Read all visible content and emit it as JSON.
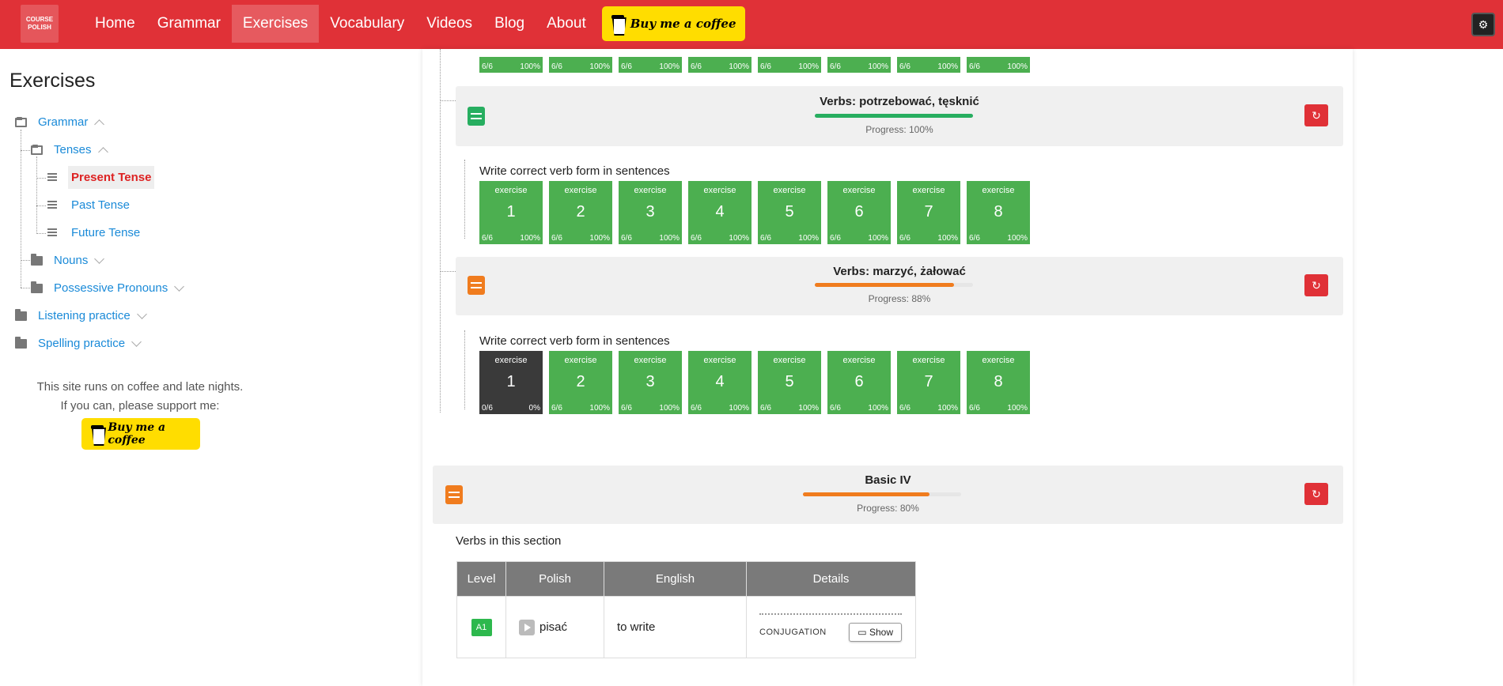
{
  "brand": {
    "logo_line1": "COURSE",
    "logo_line2": "POLISH"
  },
  "nav": {
    "home": "Home",
    "grammar": "Grammar",
    "exercises": "Exercises",
    "vocabulary": "Vocabulary",
    "videos": "Videos",
    "blog": "Blog",
    "about": "About",
    "coffee": "Buy me a coffee"
  },
  "sidebar": {
    "title": "Exercises",
    "grammar": "Grammar",
    "tenses": "Tenses",
    "present": "Present Tense",
    "past": "Past Tense",
    "future": "Future Tense",
    "nouns": "Nouns",
    "possessive": "Possessive Pronouns",
    "listening": "Listening practice",
    "spelling": "Spelling practice",
    "support1": "This site runs on coffee and late nights.",
    "support2": "If you can, please support me:",
    "coffee": "Buy me a coffee"
  },
  "exercise_label": "exercise",
  "top_row": {
    "score": "6/6",
    "pct": "100%"
  },
  "section1": {
    "title": "Verbs: potrzebować, tęsknić",
    "progress_text": "Progress: 100%",
    "progress": 100,
    "color": "#27ae60",
    "subtitle": "Write correct verb form in sentences",
    "exercises": [
      {
        "n": "1",
        "score": "6/6",
        "pct": "100%"
      },
      {
        "n": "2",
        "score": "6/6",
        "pct": "100%"
      },
      {
        "n": "3",
        "score": "6/6",
        "pct": "100%"
      },
      {
        "n": "4",
        "score": "6/6",
        "pct": "100%"
      },
      {
        "n": "5",
        "score": "6/6",
        "pct": "100%"
      },
      {
        "n": "6",
        "score": "6/6",
        "pct": "100%"
      },
      {
        "n": "7",
        "score": "6/6",
        "pct": "100%"
      },
      {
        "n": "8",
        "score": "6/6",
        "pct": "100%"
      }
    ]
  },
  "section2": {
    "title": "Verbs: marzyć, żałować",
    "progress_text": "Progress: 88%",
    "progress": 88,
    "color": "#f07c1e",
    "subtitle": "Write correct verb form in sentences",
    "exercises": [
      {
        "n": "1",
        "score": "0/6",
        "pct": "0%"
      },
      {
        "n": "2",
        "score": "6/6",
        "pct": "100%"
      },
      {
        "n": "3",
        "score": "6/6",
        "pct": "100%"
      },
      {
        "n": "4",
        "score": "6/6",
        "pct": "100%"
      },
      {
        "n": "5",
        "score": "6/6",
        "pct": "100%"
      },
      {
        "n": "6",
        "score": "6/6",
        "pct": "100%"
      },
      {
        "n": "7",
        "score": "6/6",
        "pct": "100%"
      },
      {
        "n": "8",
        "score": "6/6",
        "pct": "100%"
      }
    ]
  },
  "section3": {
    "title": "Basic IV",
    "progress_text": "Progress: 80%",
    "progress": 80,
    "color": "#f07c1e",
    "subtitle": "Verbs in this section"
  },
  "table": {
    "headers": [
      "Level",
      "Polish",
      "English",
      "Details"
    ],
    "rows": [
      {
        "level": "A1",
        "polish": "pisać",
        "english": "to write",
        "details": "CONJUGATION",
        "button": "Show"
      }
    ]
  }
}
